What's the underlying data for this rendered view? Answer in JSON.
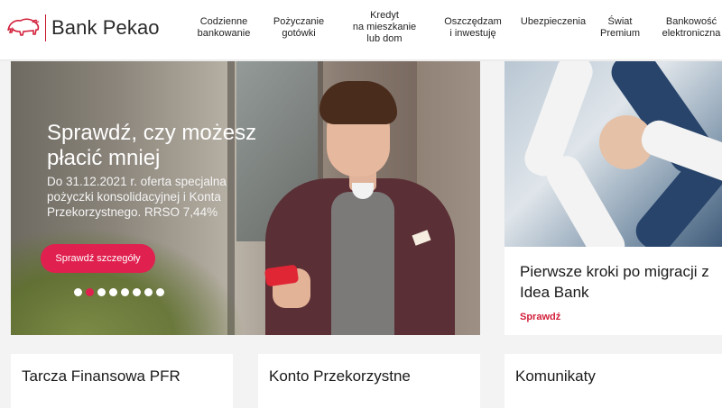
{
  "brand": {
    "name": "Bank Pekao",
    "accent_color": "#d21f3a"
  },
  "nav": {
    "items": [
      {
        "label": "Codzienne\nbankowanie"
      },
      {
        "label": "Pożyczanie\ngotówki"
      },
      {
        "label": "Kredyt\nna mieszkanie\nlub dom"
      },
      {
        "label": "Oszczędzam\ni inwestuję"
      },
      {
        "label": "Ubezpieczenia"
      },
      {
        "label": "Świat\nPremium"
      },
      {
        "label": "Bankowość\nelektroniczna"
      }
    ]
  },
  "hero": {
    "title": "Sprawdź, czy możesz płacić mniej",
    "description": "Do 31.12.2021 r. oferta specjalna pożyczki konsolidacyjnej i Konta Przekorzystnego. RRSO 7,44%",
    "button_label": "Sprawdź szczegóły",
    "slides_total": 8,
    "active_slide": 2
  },
  "side_card": {
    "title": "Pierwsze kroki po migracji z Idea Bank",
    "link_label": "Sprawdź"
  },
  "cards": [
    {
      "title": "Tarcza Finansowa PFR"
    },
    {
      "title": "Konto Przekorzystne"
    },
    {
      "title": "Komunikaty"
    }
  ]
}
